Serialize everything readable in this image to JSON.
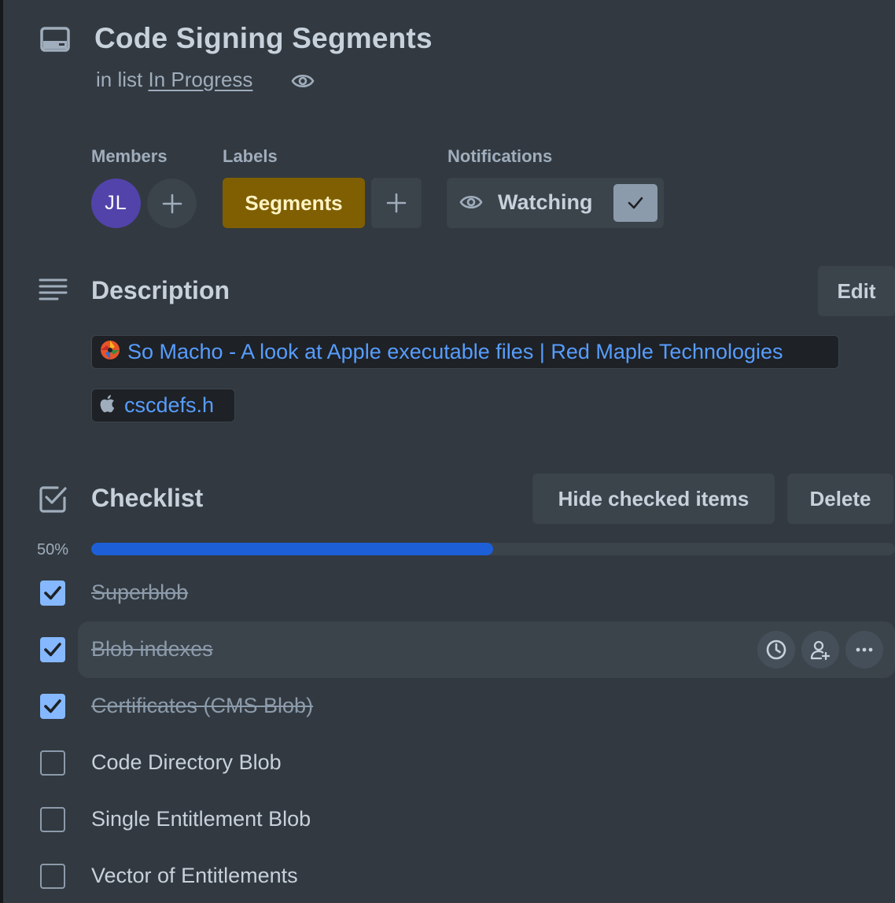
{
  "card": {
    "title": "Code Signing Segments",
    "list_prefix": "in list",
    "list_name": "In Progress"
  },
  "members": {
    "label": "Members",
    "avatars": [
      {
        "initials": "JL",
        "color": "#5243aa"
      }
    ]
  },
  "labels": {
    "label": "Labels",
    "items": [
      {
        "text": "Segments",
        "color": "#7f5f01"
      }
    ]
  },
  "notifications": {
    "label": "Notifications",
    "button": "Watching",
    "checked": true
  },
  "description": {
    "heading": "Description",
    "edit_label": "Edit",
    "links": [
      {
        "text": "So Macho - A look at Apple executable files | Red Maple Technologies",
        "icon": "red-maple-favicon-icon"
      },
      {
        "text": "cscdefs.h",
        "icon": "apple-icon"
      }
    ]
  },
  "checklist": {
    "heading": "Checklist",
    "hide_label": "Hide checked items",
    "delete_label": "Delete",
    "progress_text": "50%",
    "progress": 0.5,
    "items": [
      {
        "text": "Superblob",
        "checked": true
      },
      {
        "text": "Blob indexes",
        "checked": true
      },
      {
        "text": "Certificates (CMS Blob)",
        "checked": true
      },
      {
        "text": "Code Directory Blob",
        "checked": false
      },
      {
        "text": "Single Entitlement Blob",
        "checked": false
      },
      {
        "text": "Vector of Entitlements",
        "checked": false
      }
    ],
    "item_actions": [
      "clock-icon",
      "add-member-icon",
      "more-icon"
    ]
  },
  "colors": {
    "background": "#323940",
    "accent": "#1d5fd6",
    "link": "#579dff",
    "checkbox_checked": "#85b8ff"
  }
}
